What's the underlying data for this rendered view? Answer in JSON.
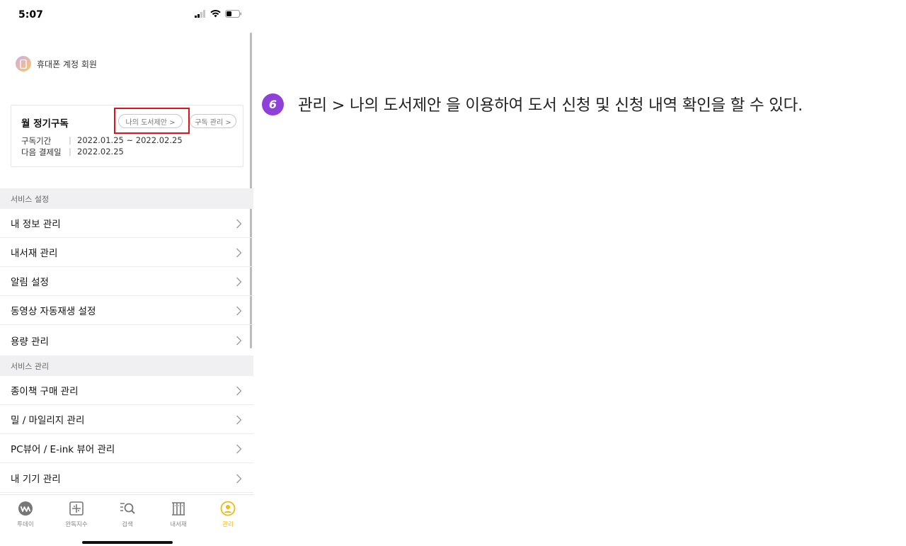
{
  "status_bar": {
    "time": "5:07"
  },
  "account": {
    "label": "휴대폰 계정 회원"
  },
  "subscription": {
    "title": "월 정기구독",
    "suggest_button": "나의 도서제안 >",
    "manage_button": "구독 관리 >",
    "period_label": "구독기간",
    "period_value": "2022.01.25 ~ 2022.02.25",
    "next_payment_label": "다음 결제일",
    "next_payment_value": "2022.02.25",
    "separator": "|"
  },
  "sections": [
    {
      "header": "서비스 설정",
      "items": [
        "내 정보 관리",
        "내서재 관리",
        "알림 설정",
        "동영상 자동재생 설정",
        "용량 관리"
      ]
    },
    {
      "header": "서비스 관리",
      "items": [
        "종이책 구매 관리",
        "밀 / 마일리지 관리",
        "PC뷰어 / E-ink 뷰어 관리",
        "내 기기 관리"
      ]
    }
  ],
  "tabbar": {
    "tabs": [
      {
        "label": "투데이",
        "icon": "today-icon"
      },
      {
        "label": "완독지수",
        "icon": "completion-index-icon"
      },
      {
        "label": "검색",
        "icon": "search-icon"
      },
      {
        "label": "내서재",
        "icon": "library-icon"
      },
      {
        "label": "관리",
        "icon": "profile-icon",
        "active": true
      }
    ],
    "active_color": "#f2b90f"
  },
  "instruction": {
    "step": "6",
    "text": "관리 > 나의 도서제안 을 이용하여 도서 신청 및 신청 내역 확인을 할 수 있다.",
    "badge_color": "#8e41d9",
    "highlight_color": "#e0121b"
  }
}
